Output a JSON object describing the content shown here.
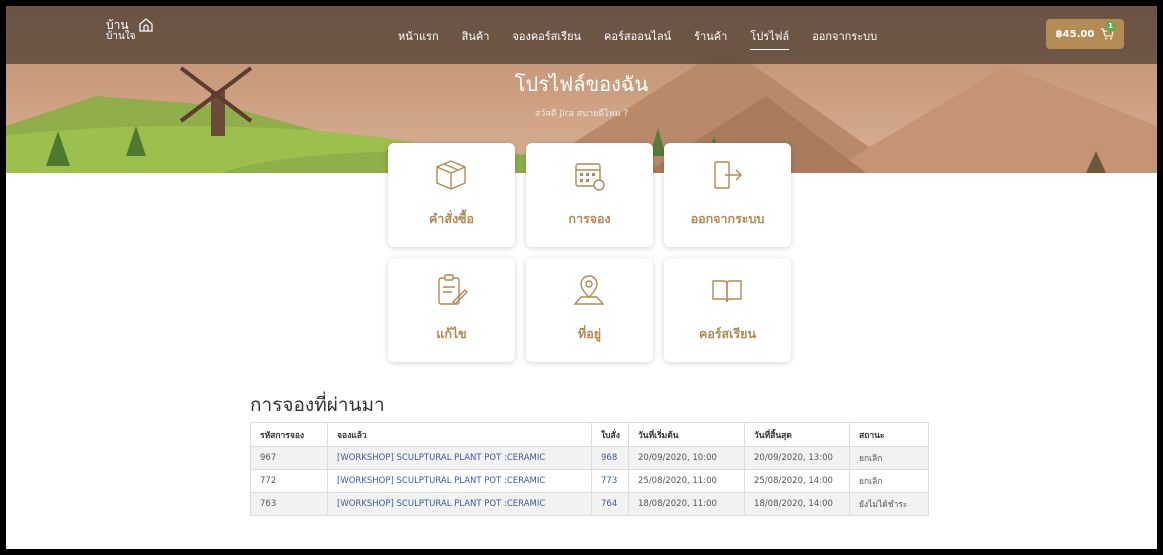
{
  "logo": {
    "line1": "บ้าน",
    "line2": "บ้านใจ"
  },
  "nav": {
    "items": [
      "หน้าแรก",
      "สินค้า",
      "จองคอร์สเรียน",
      "คอร์สออนไลน์",
      "ร้านค้า",
      "โปรไฟล์",
      "ออกจากระบบ"
    ],
    "active": "โปรไฟล์"
  },
  "cart": {
    "total": "฿45.00",
    "count": "1"
  },
  "hero": {
    "title": "โปรไฟล์ของฉัน",
    "subtitle": "สวัสดี Jira สบายดีไหม ?"
  },
  "cards": [
    {
      "label": "คำสั่งซื้อ",
      "icon": "box-icon"
    },
    {
      "label": "การจอง",
      "icon": "calendar-icon"
    },
    {
      "label": "ออกจากระบบ",
      "icon": "logout-icon"
    },
    {
      "label": "แก้ไข",
      "icon": "edit-clipboard-icon"
    },
    {
      "label": "ที่อยู่",
      "icon": "map-pin-icon"
    },
    {
      "label": "คอร์สเรียน",
      "icon": "book-icon"
    }
  ],
  "bookings": {
    "title": "การจองที่ผ่านมา",
    "headers": [
      "รหัสการจอง",
      "จองแล้ว",
      "ใบสั่ง",
      "วันที่เริ่มต้น",
      "วันที่สิ้นสุด",
      "สถานะ"
    ],
    "rows": [
      [
        "967",
        "[WORKSHOP] SCULPTURAL PLANT POT :CERAMIC",
        "968",
        "20/09/2020, 10:00",
        "20/09/2020, 13:00",
        "ยกเลิก"
      ],
      [
        "772",
        "[WORKSHOP] SCULPTURAL PLANT POT :CERAMIC",
        "773",
        "25/08/2020, 11:00",
        "25/08/2020, 14:00",
        "ยกเลิก"
      ],
      [
        "763",
        "[WORKSHOP] SCULPTURAL PLANT POT :CERAMIC",
        "764",
        "18/08/2020, 11:00",
        "18/08/2020, 14:00",
        "ยังไม่ได้ชำระ"
      ]
    ]
  },
  "colors": {
    "accent": "#b08a52",
    "cart": "#b48b55",
    "header": "#5c483c"
  }
}
